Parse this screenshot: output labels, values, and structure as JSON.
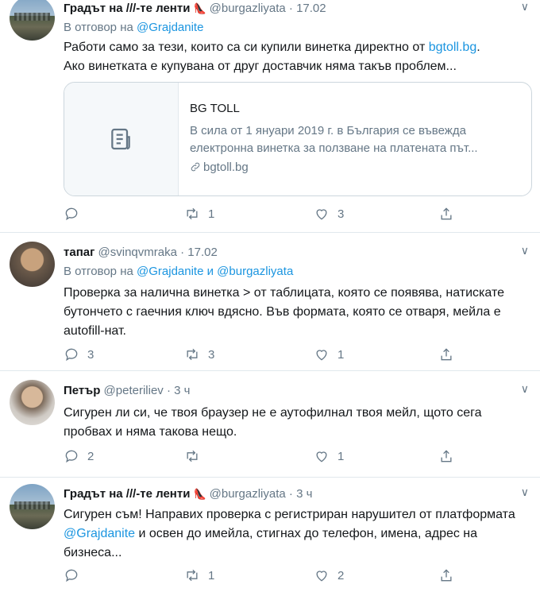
{
  "tweets": [
    {
      "name": "Градът на ///-те ленти",
      "handle": "@burgazliyata",
      "time": "17.02",
      "reply_prefix": "В отговор на",
      "reply_to": "@Grajdanite",
      "reply_join": "",
      "reply_to2": "",
      "text_line1": "Работи само за тези, които са си купили винетка директно от ",
      "text_link": "bgtoll.bg",
      "text_line1_end": ".",
      "text_line2": "Ако винетката е купувана от друг доставчик няма такъв проблем...",
      "card": {
        "title": "BG TOLL",
        "description": "В сила от 1 януари 2019 г. в България се въвежда електронна винетка за ползване на платената път...",
        "domain": "bgtoll.bg"
      },
      "replies": "",
      "retweets": "1",
      "likes": "3"
    },
    {
      "name": "тапаг",
      "handle": "@svinqvmraka",
      "time": "17.02",
      "reply_prefix": "В отговор на",
      "reply_to": "@Grajdanite",
      "reply_join": "и",
      "reply_to2": "@burgazliyata",
      "text": "Проверка за налична винетка > от таблицата, която се появява, натискате бутончето с гаечния ключ вдясно. Във формата, която се отваря, мейла е autofill-нат.",
      "replies": "3",
      "retweets": "3",
      "likes": "1"
    },
    {
      "name": "Петър",
      "handle": "@peteriliev",
      "time": "3 ч",
      "text": "Сигурен ли си, че твоя браузер не е аутофилнал твоя мейл, щото сега пробвах и няма такова нещо.",
      "replies": "2",
      "retweets": "",
      "likes": "1"
    },
    {
      "name": "Градът на ///-те ленти",
      "handle": "@burgazliyata",
      "time": "3 ч",
      "text_part1": "Сигурен съм! Направих проверка с регистриран нарушител от платформата ",
      "text_link": "@Grajdanite",
      "text_part2": " и освен до имейла, стигнах до телефон, имена, адрес на бизнеса...",
      "replies": "",
      "retweets": "1",
      "likes": "2"
    }
  ],
  "separator": "·",
  "icons": {
    "reply": "reply-icon",
    "retweet": "retweet-icon",
    "like": "heart-icon",
    "share": "share-icon",
    "menu": "chevron-down-icon",
    "badge": "shoe-emoji-icon",
    "card_placeholder": "document-icon",
    "card_link": "link-icon"
  },
  "colors": {
    "link": "#1b95e0",
    "muted": "#657786",
    "text": "#14171a",
    "divider": "#e1e8ed"
  }
}
